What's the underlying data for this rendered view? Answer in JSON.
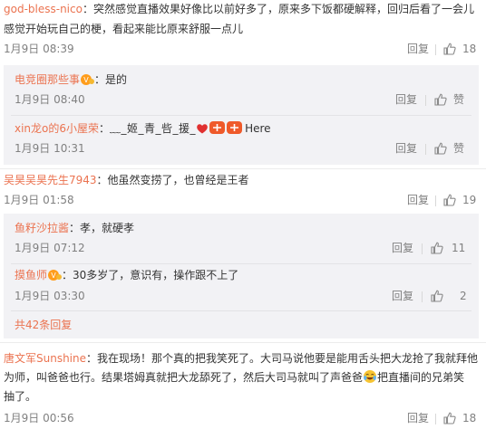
{
  "reply_label": "回复",
  "like_label": "赞",
  "thread1": {
    "user": "god-bless-nico",
    "text_line1": "：突然感觉直播效果好像比以前好多了，原来多下饭都硬解释，回归后看了一会儿",
    "text_line2": "感觉开始玩自己的梗，看起来能比原来舒服一点儿",
    "time": "1月9日 08:39",
    "likes": "18",
    "replies": [
      {
        "user": "电竞圈那些事",
        "text": "：是的",
        "time": "1月9日 08:40"
      },
      {
        "user": "xin龙o的6小屋荣",
        "text_pre": "：",
        "text_deco": "﹏_姬_青_呰_援_",
        "text_post": "Here",
        "time": "1月9日 10:31"
      }
    ]
  },
  "thread2": {
    "user": "吴昊吴昊先生7943",
    "text": "：他虽然变捞了，也曾经是王者",
    "time": "1月9日 01:58",
    "likes": "19",
    "replies": [
      {
        "user": "鱼籽沙拉酱",
        "text": "：孝，就硬孝",
        "time": "1月9日 07:12",
        "likes": "11"
      },
      {
        "user": "摸鱼师",
        "text": "：30多岁了，意识有，操作跟不上了",
        "time": "1月9日 03:30",
        "likes": "2"
      }
    ],
    "more_replies": "共42条回复"
  },
  "thread3": {
    "user": "唐文军Sunshine",
    "text_line1": "：我在现场！那个真的把我笑死了。大司马说他要是能用舌头把大龙抢了我就拜他",
    "text_line2": "为师，叫爸爸也行。结果塔姆真就把大龙舔死了，然后大司马就叫了声爸爸",
    "text_line3_post": "把直播间的兄弟笑",
    "text_line4": "抽了。",
    "time": "1月9日 00:56",
    "likes": "18"
  },
  "colors": {
    "username": "#eb7350",
    "muted": "#808080",
    "reply_bg": "#f2f2f5"
  }
}
